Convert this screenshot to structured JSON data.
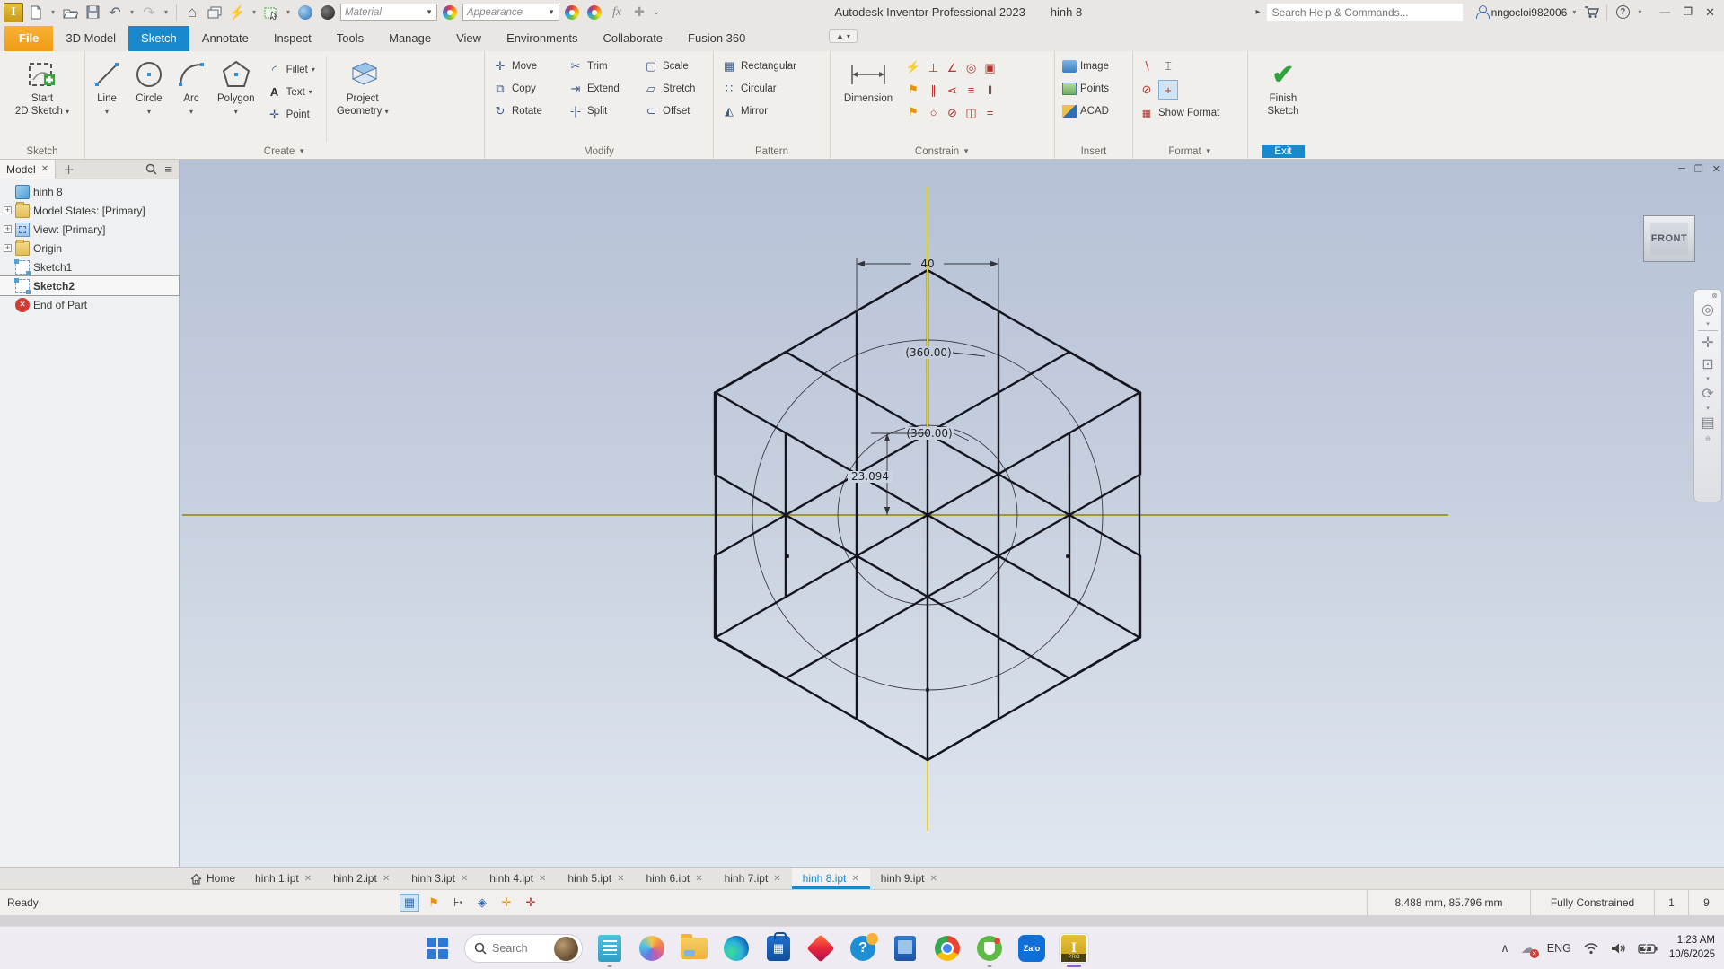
{
  "titlebar": {
    "title": "Autodesk Inventor Professional 2023",
    "document": "hinh 8",
    "material_combo": "Material",
    "appearance_combo": "Appearance",
    "search_placeholder": "Search Help & Commands...",
    "user": "nngocloi982006",
    "window_buttons": {
      "minimize": "—",
      "restore": "❐",
      "close": "✕"
    }
  },
  "ribbon": {
    "tabs": [
      {
        "label": "File",
        "cls": "file"
      },
      {
        "label": "3D Model"
      },
      {
        "label": "Sketch",
        "cls": "active"
      },
      {
        "label": "Annotate"
      },
      {
        "label": "Inspect"
      },
      {
        "label": "Tools"
      },
      {
        "label": "Manage"
      },
      {
        "label": "View"
      },
      {
        "label": "Environments"
      },
      {
        "label": "Collaborate"
      },
      {
        "label": "Fusion 360"
      }
    ],
    "sketch_panel": {
      "label": "Sketch",
      "start_line1": "Start",
      "start_line2": "2D Sketch"
    },
    "create_panel": {
      "label": "Create",
      "line": "Line",
      "circle": "Circle",
      "arc": "Arc",
      "polygon": "Polygon",
      "fillet": "Fillet",
      "text": "Text",
      "point": "Point",
      "project_line1": "Project",
      "project_line2": "Geometry"
    },
    "modify_panel": {
      "label": "Modify",
      "items": [
        {
          "glyph": "✛",
          "label": "Move"
        },
        {
          "glyph": "⧉",
          "label": "Copy"
        },
        {
          "glyph": "↻",
          "label": "Rotate"
        },
        {
          "glyph": "✂",
          "label": "Trim"
        },
        {
          "glyph": "⇥",
          "label": "Extend"
        },
        {
          "glyph": "-|-",
          "label": "Split"
        },
        {
          "glyph": "▢",
          "label": "Scale"
        },
        {
          "glyph": "▱",
          "label": "Stretch"
        },
        {
          "glyph": "⊂",
          "label": "Offset"
        }
      ]
    },
    "pattern_panel": {
      "label": "Pattern",
      "items": [
        {
          "glyph": "▦",
          "label": "Rectangular"
        },
        {
          "glyph": "∷",
          "label": "Circular"
        },
        {
          "glyph": "◭",
          "label": "Mirror"
        }
      ]
    },
    "constrain_panel": {
      "label": "Constrain",
      "dimension": "Dimension",
      "special_glyphs": [
        "⚡",
        "⚑",
        "⚑"
      ],
      "glyphs": [
        "⊥",
        "∠",
        "◎",
        "▣",
        "∥",
        "⋖",
        "≡",
        "‖",
        "○",
        "⊘",
        "◫",
        "="
      ]
    },
    "insert_panel": {
      "label": "Insert",
      "items": [
        {
          "icon": "image",
          "label": "Image"
        },
        {
          "icon": "points",
          "label": "Points"
        },
        {
          "icon": "acad",
          "label": "ACAD"
        }
      ]
    },
    "format_panel": {
      "label": "Format",
      "show_format": "Show Format",
      "glyph_line": "∖",
      "glyph_hxh": "⌶",
      "glyph_circle": "⊘",
      "glyph_center": "+"
    },
    "exit_panel": {
      "label": "Exit",
      "finish_line1": "Finish",
      "finish_line2": "Sketch"
    }
  },
  "browser": {
    "tab": "Model",
    "items": [
      {
        "label": "hinh 8",
        "icon": "part"
      },
      {
        "label": "Model States: [Primary]",
        "icon": "folder",
        "cls": "has-exp"
      },
      {
        "label": "View: [Primary]",
        "icon": "view",
        "cls": "has-exp"
      },
      {
        "label": "Origin",
        "icon": "folder",
        "cls": "has-exp"
      },
      {
        "label": "Sketch1",
        "icon": "sketch"
      },
      {
        "label": "Sketch2",
        "icon": "sketch",
        "cls": "selected"
      },
      {
        "label": "End of Part",
        "icon": "end"
      }
    ]
  },
  "canvas": {
    "viewcube": "FRONT",
    "dimensions": {
      "width": "40",
      "outer_circle": "(360.00)",
      "inner_circle": "(360.00)",
      "height": "23.094"
    }
  },
  "doctabs": {
    "home": "Home",
    "tabs": [
      {
        "label": "hinh 1.ipt"
      },
      {
        "label": "hinh 2.ipt"
      },
      {
        "label": "hinh 3.ipt"
      },
      {
        "label": "hinh 4.ipt"
      },
      {
        "label": "hinh 5.ipt"
      },
      {
        "label": "hinh 6.ipt"
      },
      {
        "label": "hinh 7.ipt"
      },
      {
        "label": "hinh 8.ipt",
        "cls": "active"
      },
      {
        "label": "hinh 9.ipt"
      }
    ]
  },
  "statusbar": {
    "ready": "Ready",
    "coords": "8.488 mm, 85.796 mm",
    "constraint_state": "Fully Constrained",
    "sketch_count": "1",
    "dof_count": "9"
  },
  "taskbar": {
    "search_placeholder": "Search",
    "tray": {
      "lang": "ENG",
      "time": "1:23 AM",
      "date": "10/6/2025"
    }
  },
  "colors": {
    "accent_blue": "#1889cc",
    "file_orange": "#f09c16",
    "axis_yellow": "#e8cf1a",
    "axis_olive": "#8f8400",
    "sketch_line": "#15151f",
    "finish_green": "#2ea33c"
  }
}
